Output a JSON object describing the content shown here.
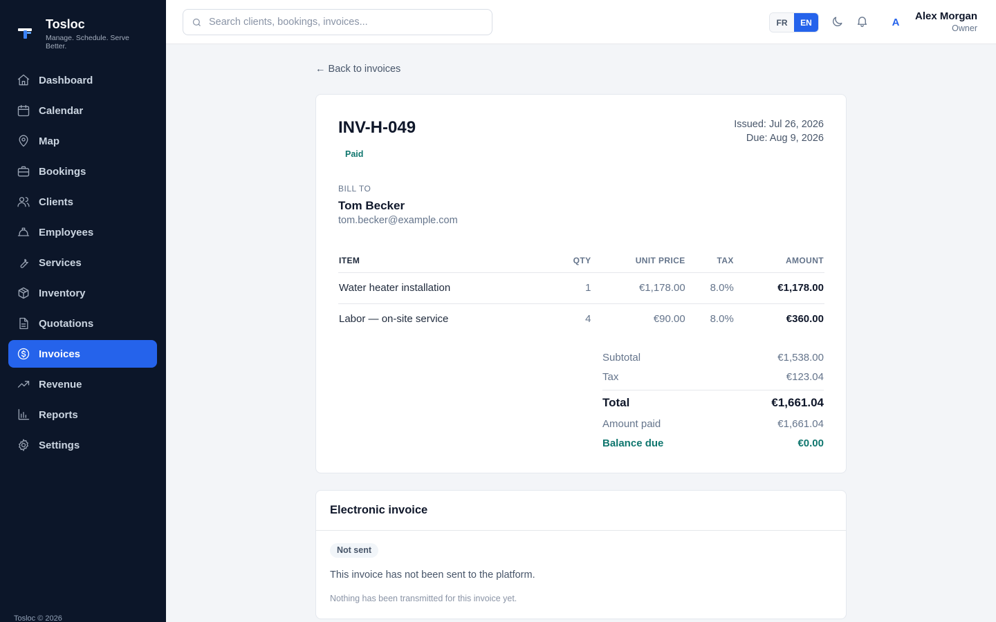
{
  "app": {
    "name": "Tosloc",
    "tagline": "Manage. Schedule. Serve Better.",
    "footer": "Tosloc © 2026"
  },
  "sidebar": {
    "items": [
      {
        "label": "Dashboard",
        "icon": "home-icon"
      },
      {
        "label": "Calendar",
        "icon": "calendar-icon"
      },
      {
        "label": "Map",
        "icon": "map-pin-icon"
      },
      {
        "label": "Bookings",
        "icon": "briefcase-icon"
      },
      {
        "label": "Clients",
        "icon": "users-icon"
      },
      {
        "label": "Employees",
        "icon": "hard-hat-icon"
      },
      {
        "label": "Services",
        "icon": "wrench-icon"
      },
      {
        "label": "Inventory",
        "icon": "package-icon"
      },
      {
        "label": "Quotations",
        "icon": "document-icon"
      },
      {
        "label": "Invoices",
        "icon": "dollar-circle-icon",
        "active": true
      },
      {
        "label": "Revenue",
        "icon": "trending-up-icon"
      },
      {
        "label": "Reports",
        "icon": "bar-chart-icon"
      },
      {
        "label": "Settings",
        "icon": "gear-icon"
      }
    ]
  },
  "topbar": {
    "search_placeholder": "Search clients, bookings, invoices...",
    "languages": [
      "FR",
      "EN"
    ],
    "active_language": "EN",
    "user": {
      "initial": "A",
      "name": "Alex Morgan",
      "role": "Owner"
    }
  },
  "main": {
    "back_link": "← Back to invoices"
  },
  "invoice": {
    "number": "INV-H-049",
    "status": "Paid",
    "issued": "Issued: Jul 26, 2026",
    "due": "Due: Aug 9, 2026",
    "bill_to_label": "BILL TO",
    "client_name": "Tom Becker",
    "client_email": "tom.becker@example.com",
    "columns": {
      "item": "ITEM",
      "qty": "QTY",
      "unit_price": "UNIT PRICE",
      "tax": "TAX",
      "amount": "AMOUNT"
    },
    "lines": [
      {
        "item": "Water heater installation",
        "qty": "1",
        "unit_price": "€1,178.00",
        "tax": "8.0%",
        "amount": "€1,178.00"
      },
      {
        "item": "Labor — on-site service",
        "qty": "4",
        "unit_price": "€90.00",
        "tax": "8.0%",
        "amount": "€360.00"
      }
    ],
    "totals": {
      "subtotal_label": "Subtotal",
      "subtotal": "€1,538.00",
      "tax_label": "Tax",
      "tax": "€123.04",
      "total_label": "Total",
      "total": "€1,661.04",
      "paid_label": "Amount paid",
      "paid": "€1,661.04",
      "balance_label": "Balance due",
      "balance": "€0.00"
    }
  },
  "einvoice": {
    "title": "Electronic invoice",
    "status": "Not sent",
    "description": "This invoice has not been sent to the platform.",
    "note": "Nothing has been transmitted for this invoice yet."
  },
  "colors": {
    "sidebar_bg": "#0c1629",
    "accent": "#2563eb",
    "paid": "#0f766e"
  }
}
